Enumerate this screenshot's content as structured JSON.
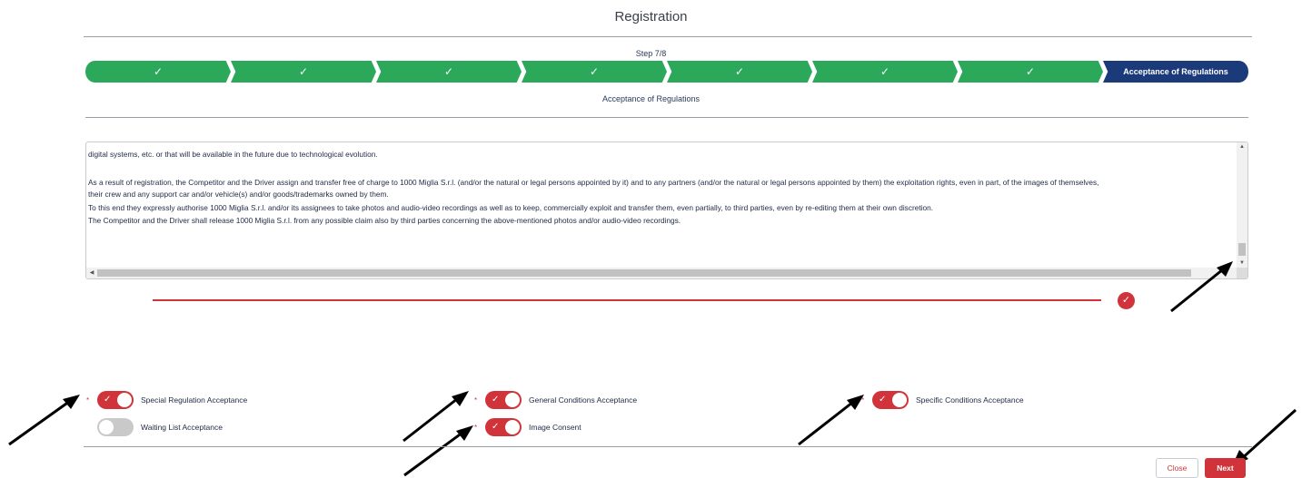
{
  "header": {
    "title": "Registration"
  },
  "steps": {
    "label": "Step 7/8",
    "subtitle": "Acceptance of Regulations",
    "completed_icon": "check-icon",
    "items": [
      {
        "label": "✓",
        "state": "completed"
      },
      {
        "label": "✓",
        "state": "completed"
      },
      {
        "label": "✓",
        "state": "completed"
      },
      {
        "label": "✓",
        "state": "completed"
      },
      {
        "label": "✓",
        "state": "completed"
      },
      {
        "label": "✓",
        "state": "completed"
      },
      {
        "label": "✓",
        "state": "completed"
      },
      {
        "label": "Acceptance of Regulations",
        "state": "active"
      }
    ],
    "colors": {
      "completed": "#2ba85a",
      "active": "#1b3a7a"
    }
  },
  "regulations": {
    "lines": [
      "digital systems, etc. or that will be available in the future due to technological evolution.",
      "As a result of registration, the Competitor and the Driver assign and transfer free of charge to 1000 Miglia S.r.l. (and/or the natural or legal persons appointed by it) and to any partners (and/or the natural or legal persons appointed by them) the exploitation rights, even in part, of the images of themselves,",
      "their crew and any support car and/or vehicle(s) and/or goods/trademarks owned by them.",
      "To this end they expressly authorise 1000 Miglia S.r.l. and/or its assignees to take photos and audio-video recordings as well as to keep, commercially exploit and transfer them, even partially, to third parties, even by re-editing them at their own discretion.",
      "The Competitor and the Driver shall release 1000 Miglia S.r.l. from any possible claim also by third parties concerning the above-mentioned photos and/or audio-video recordings."
    ]
  },
  "progress": {
    "value": 1.0,
    "color": "#d0343a",
    "icon": "check-circle-icon"
  },
  "acceptances": {
    "special_regulation": {
      "label": "Special Regulation Acceptance",
      "required": "*",
      "checked": true
    },
    "waiting_list": {
      "label": "Waiting List Acceptance",
      "required": "",
      "checked": false
    },
    "general_conditions": {
      "label": "General Conditions Acceptance",
      "required": "*",
      "checked": true
    },
    "image_consent": {
      "label": "Image Consent",
      "required": "*",
      "checked": true
    },
    "specific_conditions": {
      "label": "Specific Conditions Acceptance",
      "required": "*",
      "checked": true
    }
  },
  "footer": {
    "close_label": "Close",
    "next_label": "Next"
  },
  "colors": {
    "accent": "#d0343a",
    "arrow": "#000000"
  }
}
